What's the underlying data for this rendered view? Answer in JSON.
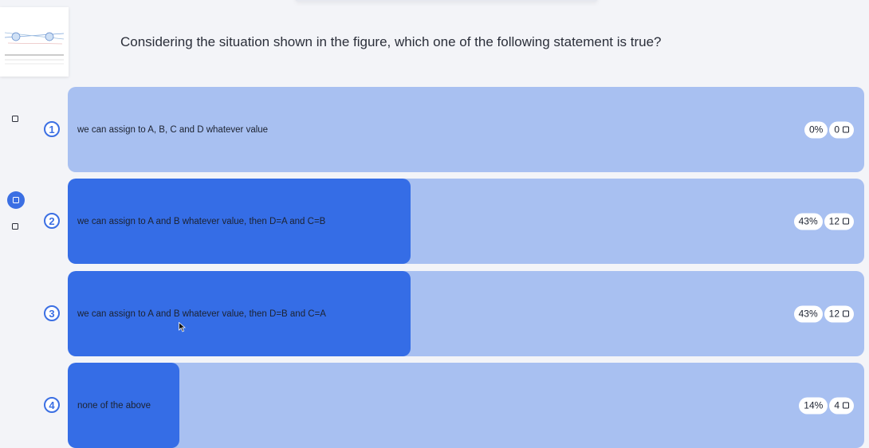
{
  "question": "Considering the situation shown in the figure, which one of the following statement is true?",
  "options": [
    {
      "number": "1",
      "text": "we can assign to A, B, C and D whatever value",
      "percent": "0%",
      "percent_value": 0,
      "count": "0"
    },
    {
      "number": "2",
      "text": "we can assign to A and B whatever value, then D=A and C=B",
      "percent": "43%",
      "percent_value": 43,
      "count": "12"
    },
    {
      "number": "3",
      "text": "we can assign to A and B whatever value, then D=B and C=A",
      "percent": "43%",
      "percent_value": 43,
      "count": "12"
    },
    {
      "number": "4",
      "text": "none of the above",
      "percent": "14%",
      "percent_value": 14,
      "count": "4"
    }
  ],
  "colors": {
    "bar_bg": "#a8c0f1",
    "bar_fill": "#356de6",
    "accent": "#3b6fe3",
    "page_bg": "#f3f4f8"
  },
  "icons": {
    "checkbox": "square-icon",
    "vote": "square-icon",
    "cursor": "mouse-pointer-icon"
  }
}
